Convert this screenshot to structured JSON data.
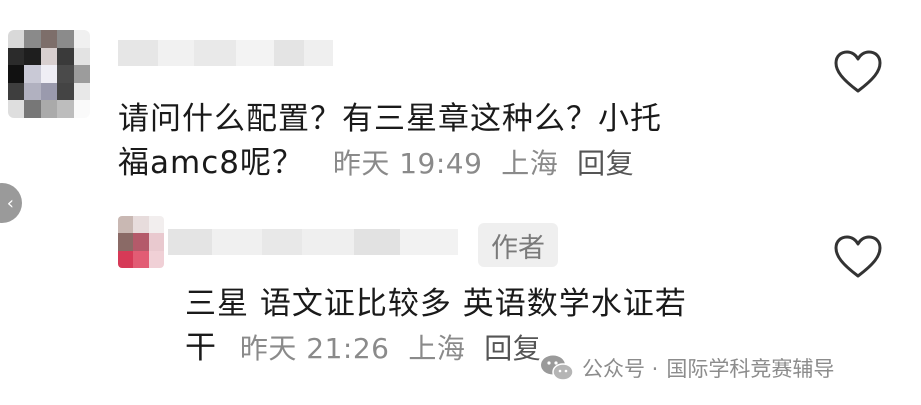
{
  "comments": [
    {
      "text_line1": "请问什么配置？有三星章这种么？小托",
      "text_line2": "福amc8呢？",
      "time": "昨天 19:49",
      "location": "上海",
      "reply": "回复"
    },
    {
      "badge": "作者",
      "text_line1": "三星 语文证比较多 英语数学水证若",
      "text_line2": "干",
      "time": "昨天 21:26",
      "location": "上海",
      "reply": "回复"
    }
  ],
  "watermark": {
    "prefix": "公众号 ·",
    "name": "国际学科竞赛辅导"
  },
  "icons": {
    "like": "heart-outline-icon",
    "collapse": "chevron-left-icon",
    "wechat": "wechat-logo-icon"
  },
  "colors": {
    "text": "#1a1a1a",
    "meta": "#8a8a8a",
    "badge_bg": "#efefef"
  }
}
